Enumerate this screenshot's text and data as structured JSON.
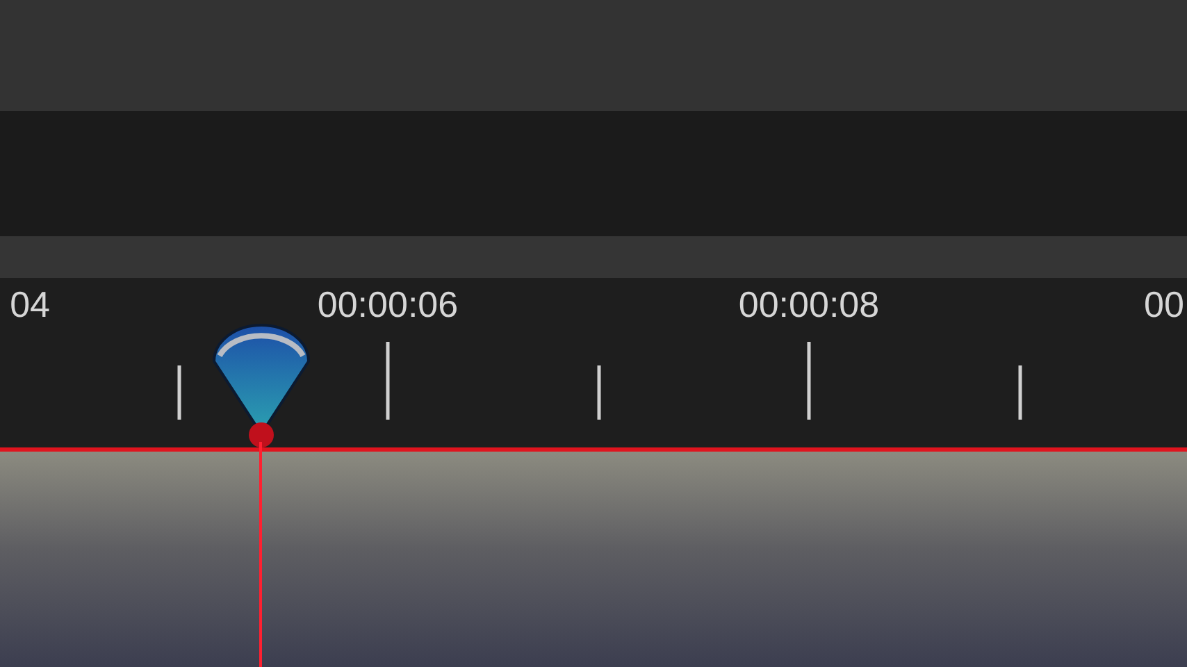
{
  "ruler": {
    "labels": [
      "04",
      "00:00:06",
      "00:00:08",
      "00"
    ]
  }
}
